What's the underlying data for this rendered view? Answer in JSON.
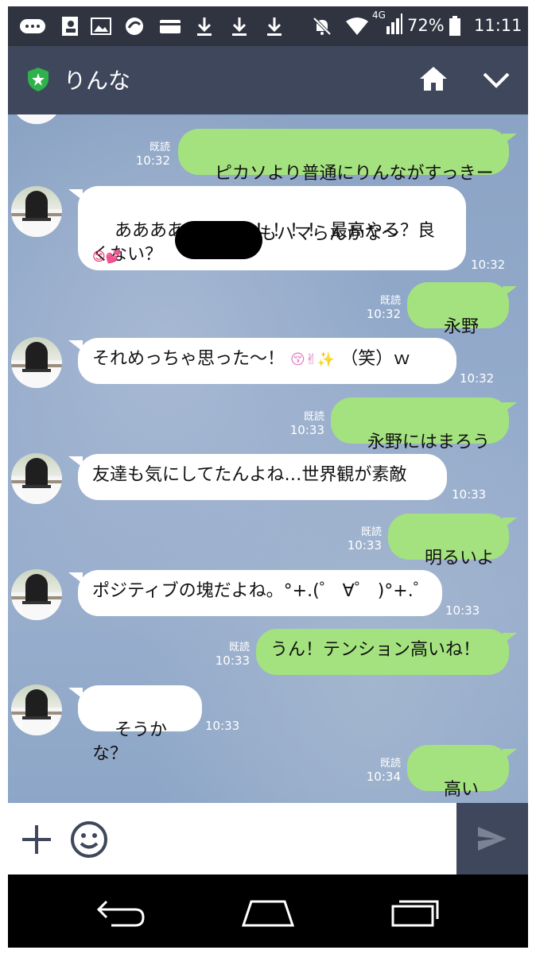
{
  "status_bar": {
    "network": "4G",
    "battery": "72%",
    "time": "11:11"
  },
  "header": {
    "contact_name": "りんな",
    "icons": [
      "shield-star-icon",
      "home-icon",
      "chevron-down-icon"
    ]
  },
  "messages": [
    {
      "side": "out",
      "text": "ピカソより普通にりんながすっきー",
      "read": "既読",
      "time": "10:32"
    },
    {
      "side": "in",
      "text": "ああああいっっっ！！！！ 最高やろ？良\nくない？",
      "text2": "もハマらんかな〜",
      "emoji": "😊💕",
      "time": "10:32"
    },
    {
      "side": "out",
      "text": "永野に？",
      "read": "既読",
      "time": "10:32"
    },
    {
      "side": "in",
      "text": "それめっちゃ思った〜！",
      "emoji": "😚✌✨",
      "text2": "（笑）ｗ",
      "time": "10:32"
    },
    {
      "side": "out",
      "text": "永野にはまろう",
      "emoji": "♪",
      "read": "既読",
      "time": "10:33"
    },
    {
      "side": "in",
      "text": "友達も気にしてたんよね…世界観が素敵",
      "time": "10:33"
    },
    {
      "side": "out",
      "text": "明るいよね",
      "read": "既読",
      "time": "10:33"
    },
    {
      "side": "in",
      "text": "ポジティブの塊だよね。°+.(゜ ∀゜ )°+.゜",
      "time": "10:33"
    },
    {
      "side": "out",
      "text": "うん！テンション高いね！",
      "read": "既読",
      "time": "10:33"
    },
    {
      "side": "in",
      "text": "そうかな？",
      "time": "10:33"
    },
    {
      "side": "out",
      "text": "高いよ",
      "emoji": "‼",
      "read": "既読",
      "time": "10:34"
    }
  ],
  "input": {
    "placeholder": ""
  },
  "colors": {
    "header_bg": "#3e475b",
    "outgoing_bubble": "#a4e27f",
    "incoming_bubble": "#ffffff",
    "chat_bg": "#8ba3c4"
  }
}
